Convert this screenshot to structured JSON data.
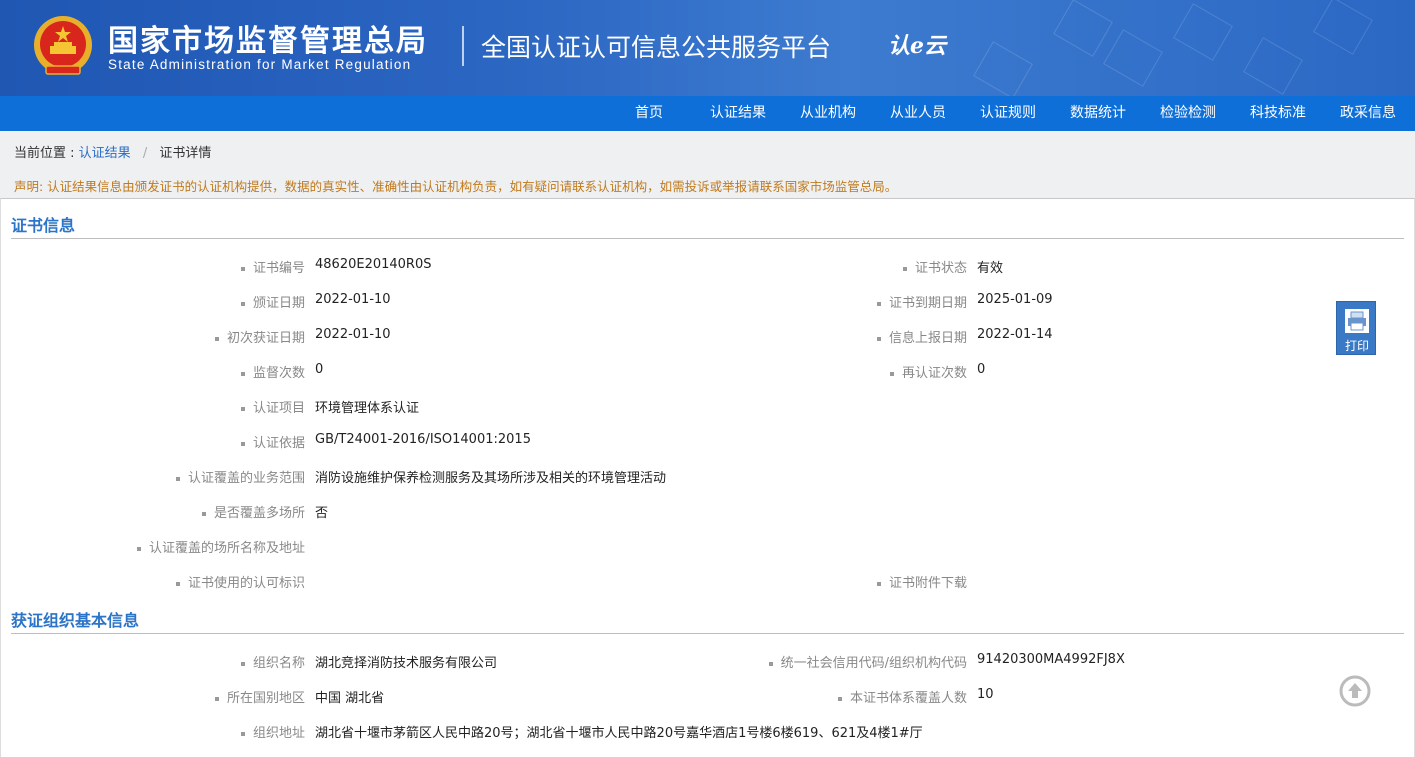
{
  "header": {
    "org_cn": "国家市场监督管理总局",
    "org_en": "State Administration  for  Market Regulation",
    "platform": "全国认证认可信息公共服务平台",
    "cloud_logo": "认e云",
    "brand_color": "#1f57b3"
  },
  "nav": {
    "items": [
      "首页",
      "认证结果",
      "从业机构",
      "从业人员",
      "认证规则",
      "数据统计",
      "检验检测",
      "科技标准",
      "政采信息"
    ],
    "color": "#0e6fd8"
  },
  "breadcrumb": {
    "prefix": "当前位置 :",
    "link": "认证结果",
    "separator": "/",
    "current": "证书详情"
  },
  "notice": "声明: 认证结果信息由颁发证书的认证机构提供，数据的真实性、准确性由认证机构负责，如有疑问请联系认证机构，如需投诉或举报请联系国家市场监管总局。",
  "cert": {
    "title": "证书信息",
    "rows": [
      {
        "l_label": "证书编号",
        "l_value": "48620E20140R0S",
        "r_label": "证书状态",
        "r_value": "有效"
      },
      {
        "l_label": "颁证日期",
        "l_value": "2022-01-10",
        "r_label": "证书到期日期",
        "r_value": "2025-01-09"
      },
      {
        "l_label": "初次获证日期",
        "l_value": "2022-01-10",
        "r_label": "信息上报日期",
        "r_value": "2022-01-14"
      },
      {
        "l_label": "监督次数",
        "l_value": "0",
        "r_label": "再认证次数",
        "r_value": "0"
      },
      {
        "l_label": "认证项目",
        "l_value": "环境管理体系认证"
      },
      {
        "l_label": "认证依据",
        "l_value": "GB/T24001-2016/ISO14001:2015"
      },
      {
        "l_label": "认证覆盖的业务范围",
        "l_value": "消防设施维护保养检测服务及其场所涉及相关的环境管理活动"
      },
      {
        "l_label": "是否覆盖多场所",
        "l_value": "否"
      },
      {
        "l_label": "认证覆盖的场所名称及地址",
        "l_value": ""
      },
      {
        "l_label": "证书使用的认可标识",
        "l_value": "",
        "r_label": "证书附件下载",
        "r_value": ""
      }
    ]
  },
  "org": {
    "title": "获证组织基本信息",
    "rows": [
      {
        "l_label": "组织名称",
        "l_value": "湖北竞择消防技术服务有限公司",
        "r_label": "统一社会信用代码/组织机构代码",
        "r_value": "91420300MA4992FJ8X"
      },
      {
        "l_label": "所在国别地区",
        "l_value": "中国 湖北省",
        "r_label": "本证书体系覆盖人数",
        "r_value": "10"
      },
      {
        "l_label": "组织地址",
        "l_value": "湖北省十堰市茅箭区人民中路20号；湖北省十堰市人民中路20号嘉华酒店1号楼6楼619、621及4楼1#厅"
      }
    ]
  },
  "print": {
    "label": "打印",
    "icon": "printer-icon"
  },
  "back_to_top": {
    "icon": "arrow-up-circle-icon"
  }
}
